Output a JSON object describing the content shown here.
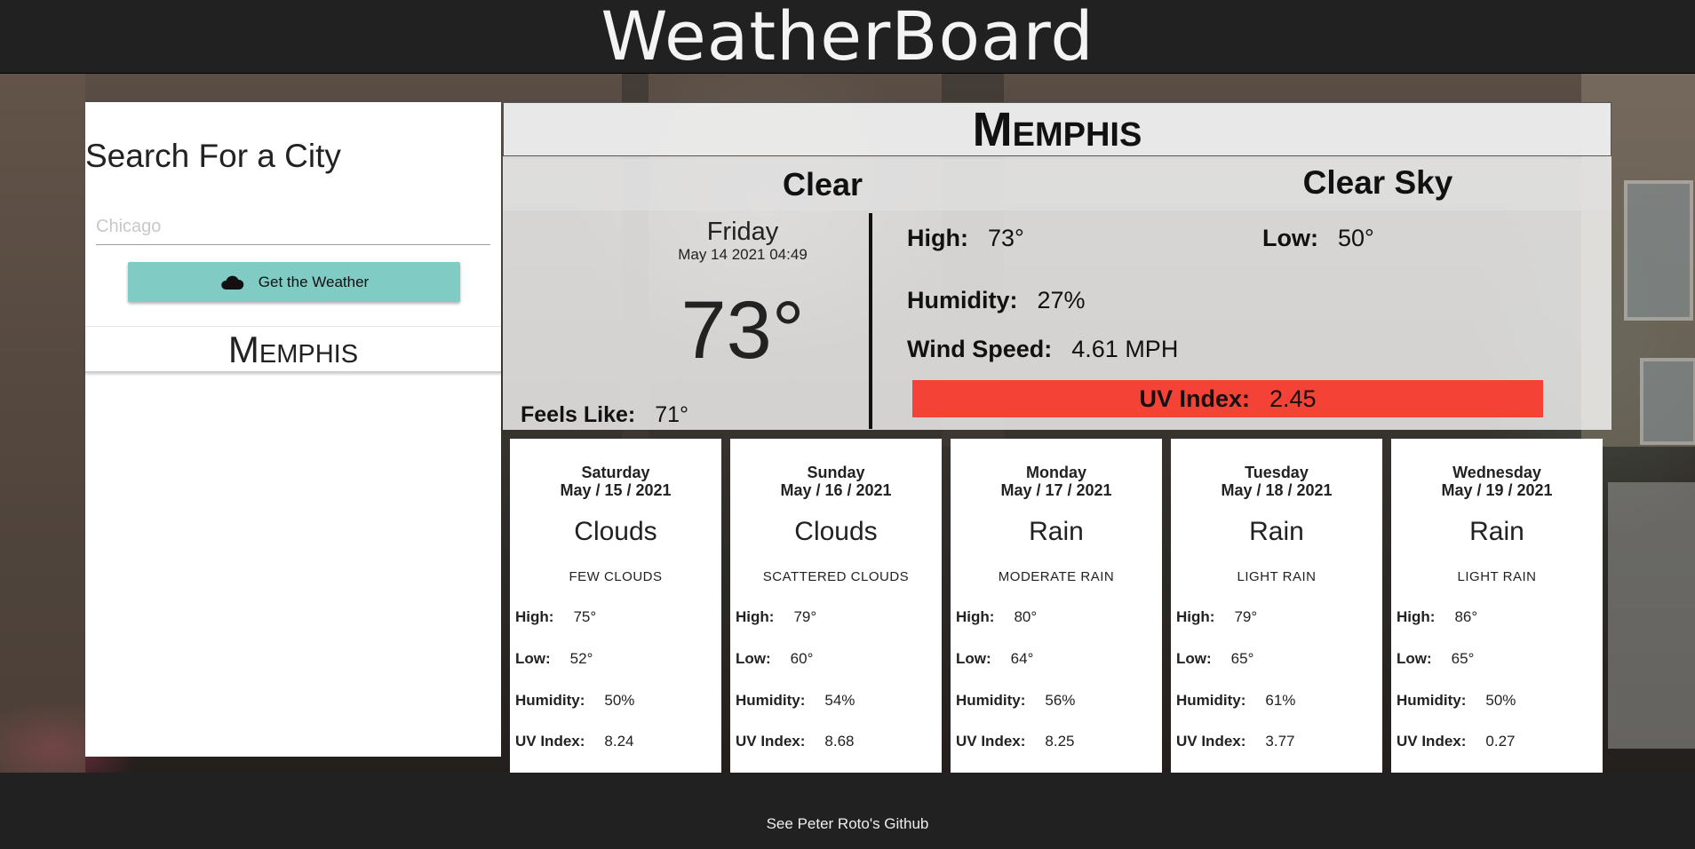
{
  "header": {
    "title": "WeatherBoard"
  },
  "sidebar": {
    "search_title": "Search For a City",
    "search_placeholder": "Chicago",
    "search_value": "",
    "button_label": "Get the Weather",
    "button_icon": "cloud-icon",
    "history": [
      {
        "city": "Memphis"
      }
    ]
  },
  "current": {
    "city": "Memphis",
    "condition": "Clear",
    "description": "Clear Sky",
    "day": "Friday",
    "date": "May 14 2021 04:49",
    "temp": "73°",
    "feels_like_label": "Feels Like:",
    "feels_like": "71°",
    "high_label": "High:",
    "high": "73°",
    "low_label": "Low:",
    "low": "50°",
    "humidity_label": "Humidity:",
    "humidity": "27%",
    "wind_label": "Wind Speed:",
    "wind": "4.61 MPH",
    "uv_label": "UV Index:",
    "uv": "2.45",
    "uv_color": "#f44336"
  },
  "forecast": [
    {
      "day": "Saturday",
      "date": "May / 15 / 2021",
      "main": "Clouds",
      "desc": "few clouds",
      "high": "75°",
      "low": "52°",
      "humidity": "50%",
      "uv": "8.24"
    },
    {
      "day": "Sunday",
      "date": "May / 16 / 2021",
      "main": "Clouds",
      "desc": "scattered clouds",
      "high": "79°",
      "low": "60°",
      "humidity": "54%",
      "uv": "8.68"
    },
    {
      "day": "Monday",
      "date": "May / 17 / 2021",
      "main": "Rain",
      "desc": "moderate rain",
      "high": "80°",
      "low": "64°",
      "humidity": "56%",
      "uv": "8.25"
    },
    {
      "day": "Tuesday",
      "date": "May / 18 / 2021",
      "main": "Rain",
      "desc": "light rain",
      "high": "79°",
      "low": "65°",
      "humidity": "61%",
      "uv": "3.77"
    },
    {
      "day": "Wednesday",
      "date": "May / 19 / 2021",
      "main": "Rain",
      "desc": "light rain",
      "high": "86°",
      "low": "65°",
      "humidity": "50%",
      "uv": "0.27"
    }
  ],
  "forecast_labels": {
    "high": "High:",
    "low": "Low:",
    "humidity": "Humidity:",
    "uv": "UV Index:"
  },
  "footer": {
    "link_text": "See Peter Roto's Github"
  },
  "colors": {
    "header_bg": "#212121",
    "button": "#80cbc4",
    "uv_high": "#f44336"
  }
}
